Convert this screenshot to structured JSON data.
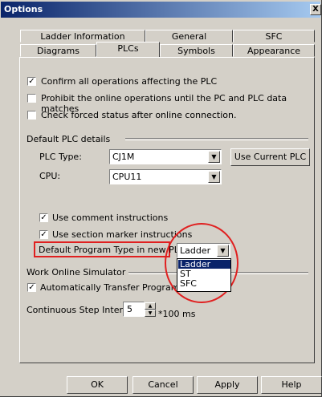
{
  "window": {
    "title": "Options",
    "close_glyph": "X"
  },
  "tabs_back": [
    "Ladder Information",
    "General",
    "SFC"
  ],
  "tabs_front": [
    "Diagrams",
    "PLCs",
    "Symbols",
    "Appearance"
  ],
  "active_tab": "PLCs",
  "checkboxes_top": [
    {
      "label": "Confirm all operations affecting the PLC",
      "checked": true
    },
    {
      "label": "Prohibit the online operations until the PC and PLC data matches",
      "checked": false
    },
    {
      "label": "Check forced status after online connection.",
      "checked": false
    }
  ],
  "default_plc": {
    "group_label": "Default PLC details",
    "plc_type_label": "PLC Type:",
    "plc_type_value": "CJ1M",
    "cpu_label": "CPU:",
    "cpu_value": "CPU11",
    "use_current_button": "Use Current PLC"
  },
  "instructions": {
    "comment_label": "Use comment instructions",
    "comment_checked": true,
    "section_label": "Use section marker instructions",
    "section_checked": true
  },
  "program_type": {
    "label": "Default Program Type in new PLC:",
    "value": "Ladder",
    "options": [
      "Ladder",
      "ST",
      "SFC"
    ],
    "selected_index": 0
  },
  "simulator": {
    "group_label": "Work Online Simulator",
    "auto_transfer_label": "Automatically Transfer Program to Si",
    "auto_transfer_checked": true
  },
  "step_interval": {
    "label": "Continuous Step Interval",
    "value": "5",
    "unit": "*100 ms"
  },
  "buttons": {
    "ok": "OK",
    "cancel": "Cancel",
    "apply": "Apply",
    "help": "Help"
  },
  "colors": {
    "title_bar": "#0a246a",
    "selection": "#0a246a",
    "highlight_box": "#e02020",
    "face": "#d4d0c8"
  }
}
